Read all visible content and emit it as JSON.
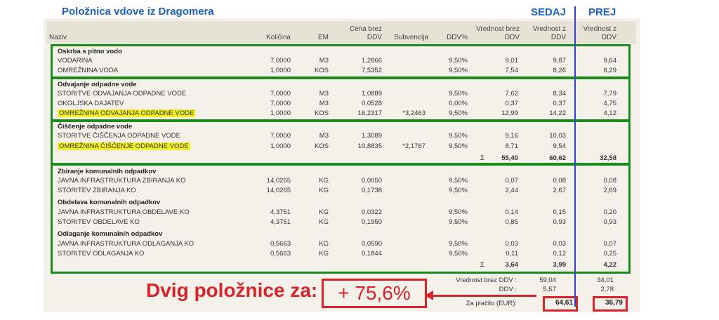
{
  "title": "Položnica vdove iz Dragomera",
  "labels": {
    "sedaj": "SEDAJ",
    "prej": "PREJ"
  },
  "headers": {
    "naziv": "Naziv",
    "kolicina": "Količina",
    "em": "EM",
    "cena_l1": "Cena brez",
    "cena_l2": "DDV",
    "subvencija": "Subvencija",
    "ddv": "DDV%",
    "vbrez_l1": "Vrednost brez",
    "vbrez_l2": "DDV",
    "vz_l1": "Vrednost z",
    "vz_l2": "DDV",
    "prej_l1": "Vrednost z",
    "prej_l2": "DDV"
  },
  "rows": [
    {
      "section": "Oskrba s pitno vodo"
    },
    {
      "name": "VODARINA",
      "kol": "7,0000",
      "em": "M3",
      "cena": "1,2866",
      "sub": "",
      "ddv": "9,50%",
      "vbrez": "9,01",
      "vz": "9,87",
      "prej": "9,64"
    },
    {
      "name": "OMREŽNINA VODA",
      "kol": "1,0000",
      "em": "KOS",
      "cena": "7,5352",
      "sub": "",
      "ddv": "9,50%",
      "vbrez": "7,54",
      "vz": "8,26",
      "prej": "6,29"
    },
    {
      "section": "Odvajanje odpadne vode"
    },
    {
      "name": "STORITVE ODVAJANJA ODPADNE VODE",
      "kol": "7,0000",
      "em": "M3",
      "cena": "1,0889",
      "sub": "",
      "ddv": "9,50%",
      "vbrez": "7,62",
      "vz": "8,34",
      "prej": "7,79"
    },
    {
      "name": "OKOLJSKA DAJATEV",
      "kol": "7,0000",
      "em": "M3",
      "cena": "0,0528",
      "sub": "",
      "ddv": "0,00%",
      "vbrez": "0,37",
      "vz": "0,37",
      "prej": "4,75"
    },
    {
      "name": "OMREŽNINA ODVAJANJA ODPADNE VODE",
      "kol": "1,0000",
      "em": "KOS",
      "cena": "16,2317",
      "sub": "*3,2463",
      "ddv": "9,50%",
      "vbrez": "12,99",
      "vz": "14,22",
      "prej": "4,12",
      "highlight": true
    },
    {
      "section": "Čiščenje odpadne vode"
    },
    {
      "name": "STORITVE ČIŠČENJA ODPADNE VODE",
      "kol": "7,0000",
      "em": "M3",
      "cena": "1,3089",
      "sub": "",
      "ddv": "9,50%",
      "vbrez": "9,16",
      "vz": "10,03",
      "prej": ""
    },
    {
      "name": "OMREŽNINA ČIŠČENJE ODPADNE VODE",
      "kol": "1,0000",
      "em": "KOS",
      "cena": "10,8835",
      "sub": "*2,1767",
      "ddv": "9,50%",
      "vbrez": "8,71",
      "vz": "9,54",
      "prej": "",
      "highlight": true
    },
    {
      "sum": true,
      "sigma": "Σ",
      "vbrez": "55,40",
      "vz": "60,62",
      "prej": "32,58"
    },
    {
      "section": "Zbiranje komunalnih odpadkov"
    },
    {
      "name": "JAVNA INFRASTRUKTURA ZBIRANJA KO",
      "kol": "14,0265",
      "em": "KG",
      "cena": "0,0050",
      "sub": "",
      "ddv": "9,50%",
      "vbrez": "0,07",
      "vz": "0,08",
      "prej": "0,08"
    },
    {
      "name": "STORITEV ZBIRANJA KO",
      "kol": "14,0265",
      "em": "KG",
      "cena": "0,1738",
      "sub": "",
      "ddv": "9,50%",
      "vbrez": "2,44",
      "vz": "2,67",
      "prej": "2,69"
    },
    {
      "section": "Obdelava komunalnih odpadkov"
    },
    {
      "name": "JAVNA INFRASTRUKTURA OBDELAVE KO",
      "kol": "4,3751",
      "em": "KG",
      "cena": "0,0322",
      "sub": "",
      "ddv": "9,50%",
      "vbrez": "0,14",
      "vz": "0,15",
      "prej": "0,20"
    },
    {
      "name": "STORITEV OBDELAVE KO",
      "kol": "4,3751",
      "em": "KG",
      "cena": "0,1950",
      "sub": "",
      "ddv": "9,50%",
      "vbrez": "0,85",
      "vz": "0,93",
      "prej": "0,93"
    },
    {
      "section": "Odlaganje komunalnih odpadkov"
    },
    {
      "name": "JAVNA INFRASTRUKTURA ODLAGANJA KO",
      "kol": "0,5663",
      "em": "KG",
      "cena": "0,0590",
      "sub": "",
      "ddv": "9,50%",
      "vbrez": "0,03",
      "vz": "0,03",
      "prej": "0,07"
    },
    {
      "name": "STORITEV ODLAGANJA KO",
      "kol": "0,5663",
      "em": "KG",
      "cena": "0,1844",
      "sub": "",
      "ddv": "9,50%",
      "vbrez": "0,11",
      "vz": "0,12",
      "prej": "0,25"
    },
    {
      "sum": true,
      "sigma": "Σ",
      "vbrez": "3,64",
      "vz": "3,99",
      "prej": "4,22"
    }
  ],
  "totals": {
    "brez_label": "Vrednost brez DDV :",
    "brez_sedaj": "59,04",
    "brez_prej": "34,01",
    "ddv_label": "DDV :",
    "ddv_sedaj": "5,57",
    "ddv_prej": "2,78",
    "placilo_label": "Za plačilo (EUR):",
    "placilo_sedaj": "64,61",
    "placilo_prej": "36,79"
  },
  "dvig": {
    "label": "Dvig položnice za:",
    "value": "+ 75,6%"
  },
  "colors": {
    "green": "#1d8a1d",
    "red": "#d8232a",
    "blue": "#1f62c6",
    "highlight": "#f4f020"
  }
}
